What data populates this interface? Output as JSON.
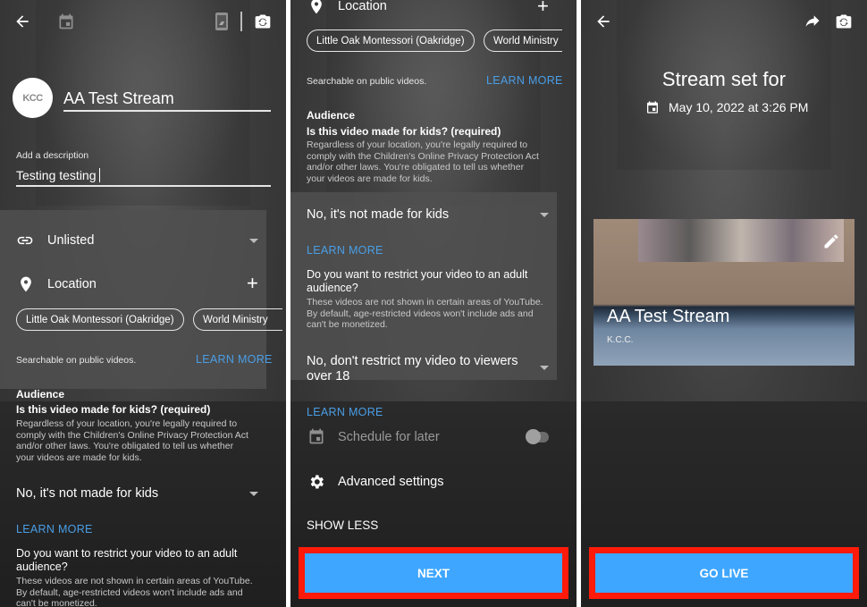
{
  "panel1": {
    "icons": {
      "back": "arrow-back",
      "schedule": "calendar",
      "share_screen": "phone-share",
      "flip_camera": "camera-flip"
    },
    "avatar_text": "KCC",
    "title_value": "AA Test Stream",
    "description_label": "Add a description",
    "description_value": "Testing testing",
    "privacy": "Unlisted",
    "location_label": "Location",
    "location_chips": [
      "Little Oak Montessori (Oakridge)",
      "World Ministry"
    ],
    "searchable_note": "Searchable on public videos.",
    "learn_more": "LEARN MORE",
    "audience_heading": "Audience",
    "kids_question": "Is this video made for kids? (required)",
    "kids_explainer_lines": [
      "Regardless of your location, you're legally required to",
      "comply with the Children's Online Privacy Protection Act",
      "and/or other laws. You're obligated to tell us whether",
      "your videos are made for kids."
    ],
    "kids_selection": "No, it's not made for kids",
    "kids_learn_more": "LEARN MORE",
    "adult_question_lines": [
      "Do you want to restrict your video to an adult",
      "audience?"
    ],
    "adult_explainer_lines": [
      "These videos are not shown in certain areas of YouTube.",
      "By default, age-restricted videos won't include ads and",
      "can't be monetized."
    ]
  },
  "panel2": {
    "location_label": "Location",
    "location_chips": [
      "Little Oak Montessori (Oakridge)",
      "World Ministry"
    ],
    "searchable_note": "Searchable on public videos.",
    "learn_more": "LEARN MORE",
    "audience_heading": "Audience",
    "kids_question": "Is this video made for kids? (required)",
    "kids_explainer_lines": [
      "Regardless of your location, you're legally required to",
      "comply with the Children's Online Privacy Protection Act",
      "and/or other laws. You're obligated to tell us whether",
      "your videos are made for kids."
    ],
    "kids_selection": "No, it's not made for kids",
    "kids_learn_more": "LEARN MORE",
    "adult_question_lines": [
      "Do you want to restrict your video to an adult",
      "audience?"
    ],
    "adult_explainer_lines": [
      "These videos are not shown in certain areas of YouTube.",
      "By default, age-restricted videos won't include ads and",
      "can't be monetized."
    ],
    "adult_selection_lines": [
      "No, don't restrict my video to viewers",
      "over 18"
    ],
    "adult_learn_more": "LEARN MORE",
    "schedule_label": "Schedule for later",
    "schedule_enabled": false,
    "advanced_label": "Advanced settings",
    "show_less": "SHOW LESS",
    "next_button": "NEXT"
  },
  "panel3": {
    "heading": "Stream set for",
    "datetime": "May 10, 2022 at 3:26 PM",
    "card_title": "AA Test Stream",
    "card_channel": "K.C.C.",
    "go_live_button": "GO LIVE"
  },
  "colors": {
    "accent_blue": "#3ea6ff",
    "link_blue": "#4a9ee6",
    "highlight_red": "#ff1a0a"
  }
}
